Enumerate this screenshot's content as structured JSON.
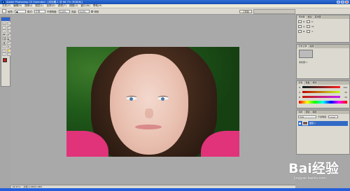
{
  "app": {
    "title": "Adobe Photoshop CS Extended - [未标题-1 @ 66.7% (RGB/8)]"
  },
  "window_controls": [
    "minimize",
    "maximize",
    "close"
  ],
  "menu": [
    "文件(F)",
    "编辑(E)",
    "图像(I)",
    "图层(L)",
    "选择(S)",
    "滤镜(T)",
    "视图(V)",
    "窗口(W)",
    "帮助(H)"
  ],
  "options": {
    "brush_label": "画笔:",
    "mode_label": "模式:",
    "mode_value": "正常",
    "opacity_label": "不透明度:",
    "opacity_value": "100%",
    "flow_label": "流量:",
    "flow_value": "100%",
    "airbrush_label": "喷枪",
    "workspace_button": "工作区"
  },
  "tools": [
    "▭",
    "⊹",
    "◌",
    "✂",
    "⌗",
    "✎",
    "✚",
    "⊘",
    "⌫",
    "◐",
    "▲",
    "⊙",
    "T",
    "✦",
    "◇",
    "✋",
    "⌕",
    "▢"
  ],
  "navigator": {
    "tabs": [
      "导航器",
      "信息",
      "直方图"
    ],
    "values": [
      "R:",
      "G:",
      "B:",
      "C:",
      "M:",
      "Y:"
    ]
  },
  "history": {
    "tabs": [
      "历史记录",
      "动作"
    ],
    "description": "未标题-1"
  },
  "color_panel": {
    "tabs": [
      "颜色",
      "色板",
      "样式"
    ],
    "sliders": [
      {
        "label": "R",
        "value": "194",
        "gradient": "linear-gradient(90deg,#001e1e,#ff1e1e)"
      },
      {
        "label": "G",
        "value": "30",
        "gradient": "linear-gradient(90deg,#c20000,#c2ff1e)"
      },
      {
        "label": "B",
        "value": "30",
        "gradient": "linear-gradient(90deg,#c21e00,#c21eff)"
      }
    ]
  },
  "layers": {
    "tabs": [
      "图层",
      "通道",
      "路径"
    ],
    "mode": "正常",
    "opacity_label": "不透明度:",
    "opacity": "100%",
    "layer_name": "图层 1"
  },
  "status": {
    "zoom": "66.67%",
    "doc": "文档:1.08M/1.08M"
  },
  "watermark": {
    "brand": "Bai经验",
    "url": "jingyan.baidu.com"
  },
  "colors": {
    "foreground": "#c21e1e",
    "background": "#ffffff",
    "accent": "#316ac5"
  }
}
